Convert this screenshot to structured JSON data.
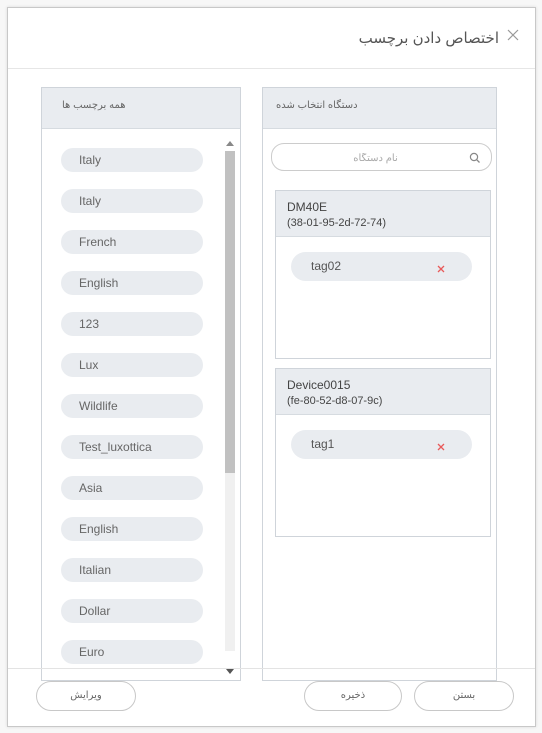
{
  "dialog": {
    "title": "اختصاص دادن برچسب",
    "close_icon": "close-icon"
  },
  "all_tags": {
    "header": "همه برچسب ها",
    "items": [
      "Italy",
      "Italy",
      "French",
      "English",
      "123",
      "Lux",
      "Wildlife",
      "Test_luxottica",
      "Asia",
      "English",
      "Italian",
      "Dollar",
      "Euro"
    ]
  },
  "selected": {
    "header": "دستگاه انتخاب شده",
    "search_placeholder": "نام دستگاه",
    "search_icon": "search-icon",
    "devices": [
      {
        "name": "DM40E",
        "mac": "(38-01-95-2d-72-74)",
        "tags": [
          "tag02"
        ]
      },
      {
        "name": "Device0015",
        "mac": "(fe-80-52-d8-07-9c)",
        "tags": [
          "tag1"
        ]
      }
    ],
    "remove_icon": "remove-x-icon",
    "remove_color": "#e85a5a"
  },
  "buttons": {
    "edit": "ویرایش",
    "save": "ذخیره",
    "close": "بستن"
  }
}
